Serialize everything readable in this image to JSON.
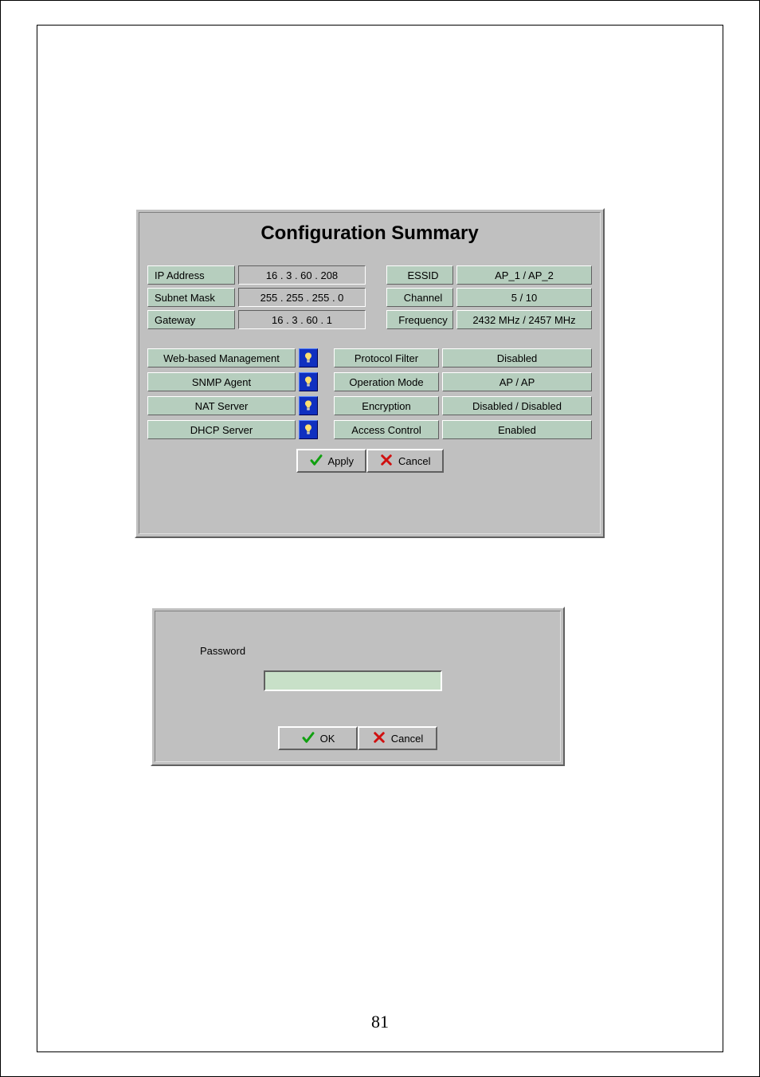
{
  "page_number": "81",
  "config": {
    "title": "Configuration Summary",
    "net": {
      "ip_label": "IP Address",
      "ip_value": "16  .  3  .  60  . 208",
      "subnet_label": "Subnet Mask",
      "subnet_value": "255 . 255 . 255 .  0",
      "gateway_label": "Gateway",
      "gateway_value": "16  .  3  .  60  .  1"
    },
    "wifi": {
      "essid_label": "ESSID",
      "essid_value": "AP_1 / AP_2",
      "channel_label": "Channel",
      "channel_value": "5 / 10",
      "freq_label": "Frequency",
      "freq_value": "2432 MHz / 2457 MHz"
    },
    "services": {
      "web_label": "Web-based Management",
      "snmp_label": "SNMP Agent",
      "nat_label": "NAT Server",
      "dhcp_label": "DHCP Server"
    },
    "settings": {
      "proto_label": "Protocol Filter",
      "proto_value": "Disabled",
      "opmode_label": "Operation Mode",
      "opmode_value": "AP / AP",
      "enc_label": "Encryption",
      "enc_value": "Disabled / Disabled",
      "acl_label": "Access Control",
      "acl_value": "Enabled"
    },
    "buttons": {
      "apply": "Apply",
      "cancel": "Cancel"
    }
  },
  "password": {
    "label": "Password",
    "value": "",
    "ok": "OK",
    "cancel": "Cancel"
  }
}
